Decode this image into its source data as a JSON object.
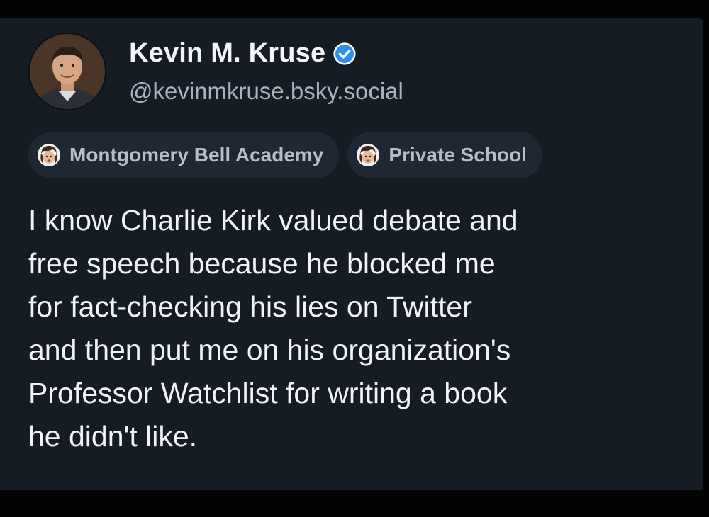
{
  "post": {
    "author": {
      "display_name": "Kevin M. Kruse",
      "handle": "@kevinmkruse.bsky.social",
      "verified": true,
      "verified_icon": "verified-check-icon",
      "avatar": "avatar-photo"
    },
    "tags": [
      {
        "label": "Montgomery Bell Academy",
        "icon": "face-emoji-icon"
      },
      {
        "label": "Private School",
        "icon": "face-emoji-icon"
      }
    ],
    "text": "I know Charlie Kirk valued debate and\nfree speech because he blocked me\nfor fact-checking his lies on Twitter\nand then put me on his organization's\nProfessor Watchlist for writing a book\nhe didn't like."
  },
  "colors": {
    "background": "#161c24",
    "text": "#f1f3f6",
    "handle": "#a8b3c0",
    "tag_background": "#1e2732",
    "verified": "#2f8ff0"
  }
}
